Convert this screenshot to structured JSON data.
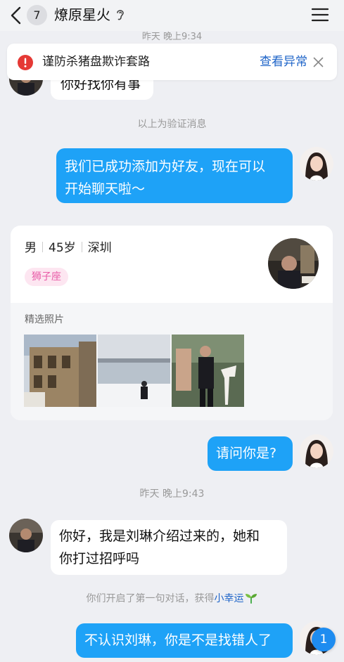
{
  "header": {
    "unread_count": "7",
    "contact_name": "燎原星火",
    "icons": [
      "back-chevron-icon",
      "ear-icon",
      "menu-icon"
    ]
  },
  "alert": {
    "text": "谨防杀猪盘欺诈套路",
    "link": "查看异常",
    "icons": [
      "warning-icon",
      "close-icon"
    ],
    "accent_color": "#e53935"
  },
  "messages": {
    "peek_time": "昨天 晚上9:34",
    "first_message": "你好找你有事",
    "verification_note": "以上为验证消息",
    "friend_added_line1": "我们已成功添加为好友，现在可以",
    "friend_added_line2": "开始聊天啦～",
    "who_are_you": "请问你是?",
    "time_2": "昨天 晚上9:43",
    "intro_line1": "你好，我是刘琳介绍过来的，她和",
    "intro_line2": "你打过招呼吗",
    "first_chat_prefix": "你们开启了第一句对话，获得",
    "first_chat_lucky": "小幸运",
    "reply": "不认识刘琳，你是不是找错人了"
  },
  "profile_card": {
    "gender": "男",
    "age": "45岁",
    "city": "深圳",
    "zodiac_tag": "狮子座",
    "photos_label": "精选照片",
    "photos": [
      "old-building-photo",
      "snow-lake-photo",
      "event-man-photo"
    ]
  },
  "unread_bubble": "1",
  "colors": {
    "outgoing_bubble": "#1ea2f7",
    "link_blue": "#1e64c8",
    "background": "#eeeff3",
    "zodiac_pink": "#e85aa6"
  }
}
